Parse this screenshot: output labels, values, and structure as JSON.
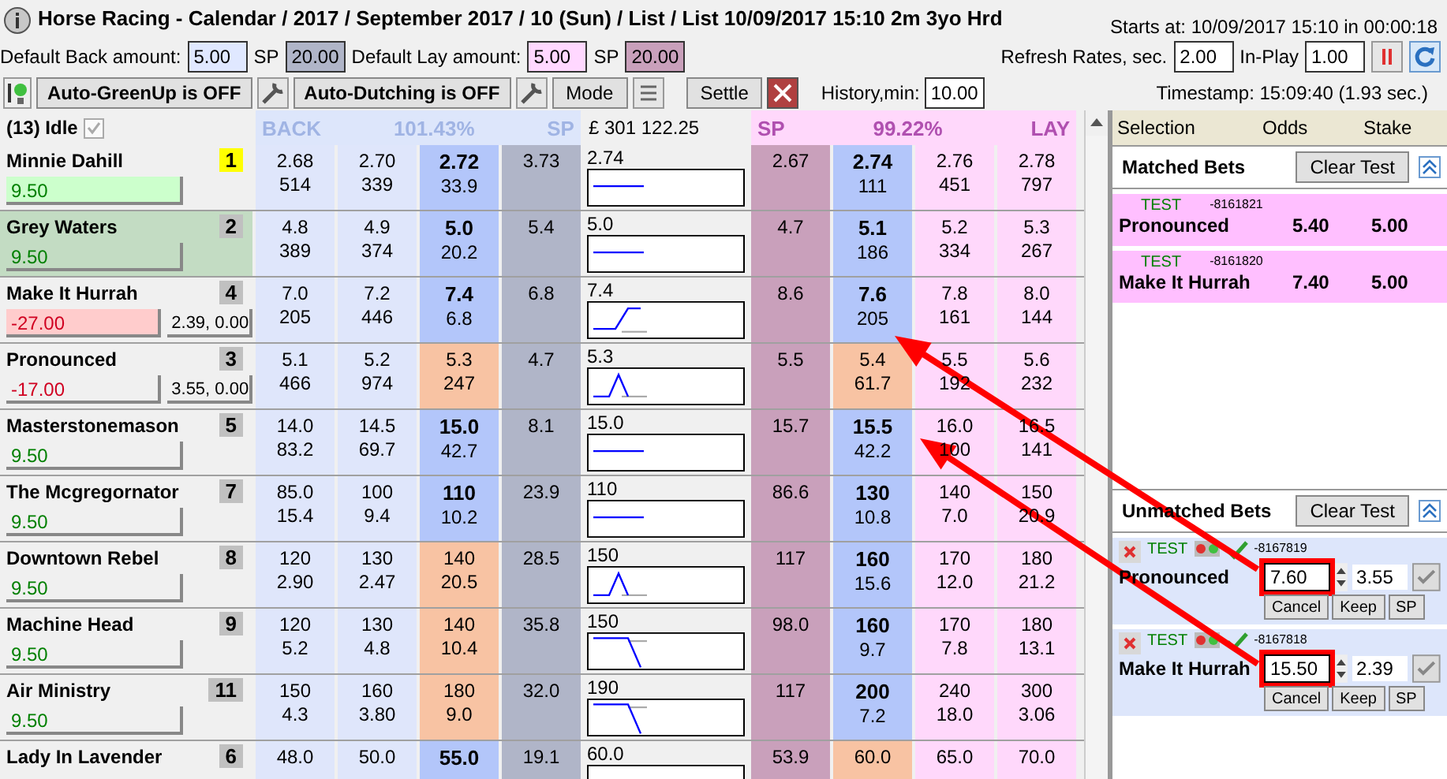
{
  "window": {
    "title": "Horse Racing - Calendar / 2017 / September 2017 / 10 (Sun) / List / List 10/09/2017 15:10 2m 3yo Hrd",
    "starts_at": "Starts at: 10/09/2017 15:10 in 00:00:18"
  },
  "amounts": {
    "back_label": "Default Back amount:",
    "back_value": "5.00",
    "back_sp_label": "SP",
    "back_sp_value": "20.00",
    "lay_label": "Default Lay amount:",
    "lay_value": "5.00",
    "lay_sp_label": "SP",
    "lay_sp_value": "20.00",
    "refresh_label": "Refresh Rates, sec.",
    "refresh_value": "2.00",
    "inplay_label": "In-Play",
    "inplay_value": "1.00"
  },
  "toolbar": {
    "greenup": "Auto-GreenUp is OFF",
    "dutching": "Auto-Dutching is OFF",
    "mode": "Mode",
    "settle": "Settle",
    "history_label": "History,min:",
    "history_value": "10.00",
    "timestamp": "Timestamp: 15:09:40 (1.93 sec.)"
  },
  "market": {
    "status": "(13) Idle",
    "status_checked": true,
    "back_label": "BACK",
    "back_percent": "101.43%",
    "back_sp": "SP",
    "matched": "£ 301 122.25",
    "lay_sp": "SP",
    "lay_percent": "99.22%",
    "lay_label": "LAY"
  },
  "runners": [
    {
      "name": "Minnie Dahill",
      "number": "1",
      "color": "#ffff00",
      "selected": false,
      "pl": {
        "value": "9.50",
        "kind": "profit",
        "highlighted": true
      },
      "back": [
        {
          "odds": "2.68",
          "amount": "514",
          "kind": "back"
        },
        {
          "odds": "2.70",
          "amount": "339",
          "kind": "back"
        },
        {
          "odds": "2.72",
          "amount": "33.9",
          "kind": "best"
        }
      ],
      "sp_back": "3.73",
      "chart_price": "2.74",
      "sparkline": {
        "kind": "flat"
      },
      "sp_lay": "2.67",
      "lay": [
        {
          "odds": "2.74",
          "amount": "111",
          "kind": "best"
        },
        {
          "odds": "2.76",
          "amount": "451",
          "kind": "lay"
        },
        {
          "odds": "2.78",
          "amount": "797",
          "kind": "lay"
        }
      ]
    },
    {
      "name": "Grey Waters",
      "number": "2",
      "color": "#c0c0c0",
      "selected": true,
      "pl": {
        "value": "9.50",
        "kind": "profit",
        "highlighted": false
      },
      "back": [
        {
          "odds": "4.8",
          "amount": "389",
          "kind": "back"
        },
        {
          "odds": "4.9",
          "amount": "374",
          "kind": "back"
        },
        {
          "odds": "5.0",
          "amount": "20.2",
          "kind": "best"
        }
      ],
      "sp_back": "5.4",
      "chart_price": "5.0",
      "sparkline": {
        "kind": "flat"
      },
      "sp_lay": "4.7",
      "lay": [
        {
          "odds": "5.1",
          "amount": "186",
          "kind": "best"
        },
        {
          "odds": "5.2",
          "amount": "334",
          "kind": "lay"
        },
        {
          "odds": "5.3",
          "amount": "267",
          "kind": "lay"
        }
      ]
    },
    {
      "name": "Make It Hurrah",
      "number": "4",
      "color": "#c0c0c0",
      "selected": false,
      "pl": {
        "value": "-27.00",
        "kind": "loss",
        "highlighted": true
      },
      "hedge": "2.39, 0.00",
      "back": [
        {
          "odds": "7.0",
          "amount": "205",
          "kind": "back"
        },
        {
          "odds": "7.2",
          "amount": "446",
          "kind": "back"
        },
        {
          "odds": "7.4",
          "amount": "6.8",
          "kind": "best"
        }
      ],
      "sp_back": "6.8",
      "chart_price": "7.4",
      "sparkline": {
        "kind": "rise"
      },
      "sp_lay": "8.6",
      "lay": [
        {
          "odds": "7.6",
          "amount": "205",
          "kind": "best"
        },
        {
          "odds": "7.8",
          "amount": "161",
          "kind": "lay"
        },
        {
          "odds": "8.0",
          "amount": "144",
          "kind": "lay"
        }
      ]
    },
    {
      "name": "Pronounced",
      "number": "3",
      "color": "#c0c0c0",
      "selected": false,
      "pl": {
        "value": "-17.00",
        "kind": "loss",
        "highlighted": false
      },
      "hedge": "3.55, 0.00",
      "back": [
        {
          "odds": "5.1",
          "amount": "466",
          "kind": "back"
        },
        {
          "odds": "5.2",
          "amount": "974",
          "kind": "back"
        },
        {
          "odds": "5.3",
          "amount": "247",
          "kind": "traded"
        }
      ],
      "sp_back": "4.7",
      "chart_price": "5.3",
      "sparkline": {
        "kind": "spike"
      },
      "sp_lay": "5.5",
      "lay": [
        {
          "odds": "5.4",
          "amount": "61.7",
          "kind": "traded"
        },
        {
          "odds": "5.5",
          "amount": "192",
          "kind": "lay"
        },
        {
          "odds": "5.6",
          "amount": "232",
          "kind": "lay"
        }
      ]
    },
    {
      "name": "Masterstonemason",
      "number": "5",
      "color": "#c0c0c0",
      "selected": false,
      "pl": {
        "value": "9.50",
        "kind": "profit",
        "highlighted": false
      },
      "back": [
        {
          "odds": "14.0",
          "amount": "83.2",
          "kind": "back"
        },
        {
          "odds": "14.5",
          "amount": "69.7",
          "kind": "back"
        },
        {
          "odds": "15.0",
          "amount": "42.7",
          "kind": "best"
        }
      ],
      "sp_back": "8.1",
      "chart_price": "15.0",
      "sparkline": {
        "kind": "flat"
      },
      "sp_lay": "15.7",
      "lay": [
        {
          "odds": "15.5",
          "amount": "42.2",
          "kind": "best"
        },
        {
          "odds": "16.0",
          "amount": "100",
          "kind": "lay"
        },
        {
          "odds": "16.5",
          "amount": "141",
          "kind": "lay"
        }
      ]
    },
    {
      "name": "The Mcgregornator",
      "number": "7",
      "color": "#c0c0c0",
      "selected": false,
      "pl": {
        "value": "9.50",
        "kind": "profit",
        "highlighted": false
      },
      "back": [
        {
          "odds": "85.0",
          "amount": "15.4",
          "kind": "back"
        },
        {
          "odds": "100",
          "amount": "9.4",
          "kind": "back"
        },
        {
          "odds": "110",
          "amount": "10.2",
          "kind": "best"
        }
      ],
      "sp_back": "23.9",
      "chart_price": "110",
      "sparkline": {
        "kind": "flat"
      },
      "sp_lay": "86.6",
      "lay": [
        {
          "odds": "130",
          "amount": "10.8",
          "kind": "best"
        },
        {
          "odds": "140",
          "amount": "7.0",
          "kind": "lay"
        },
        {
          "odds": "150",
          "amount": "20.9",
          "kind": "lay"
        }
      ]
    },
    {
      "name": "Downtown Rebel",
      "number": "8",
      "color": "#c0c0c0",
      "selected": false,
      "pl": {
        "value": "9.50",
        "kind": "profit",
        "highlighted": false
      },
      "back": [
        {
          "odds": "120",
          "amount": "2.90",
          "kind": "back"
        },
        {
          "odds": "130",
          "amount": "2.47",
          "kind": "back"
        },
        {
          "odds": "140",
          "amount": "20.5",
          "kind": "traded"
        }
      ],
      "sp_back": "28.5",
      "chart_price": "150",
      "sparkline": {
        "kind": "spike"
      },
      "sp_lay": "117",
      "lay": [
        {
          "odds": "160",
          "amount": "15.6",
          "kind": "best"
        },
        {
          "odds": "170",
          "amount": "12.0",
          "kind": "lay"
        },
        {
          "odds": "180",
          "amount": "21.2",
          "kind": "lay"
        }
      ]
    },
    {
      "name": "Machine Head",
      "number": "9",
      "color": "#c0c0c0",
      "selected": false,
      "pl": {
        "value": "9.50",
        "kind": "profit",
        "highlighted": false
      },
      "back": [
        {
          "odds": "120",
          "amount": "5.2",
          "kind": "back"
        },
        {
          "odds": "130",
          "amount": "4.8",
          "kind": "back"
        },
        {
          "odds": "140",
          "amount": "10.4",
          "kind": "traded"
        }
      ],
      "sp_back": "35.8",
      "chart_price": "150",
      "sparkline": {
        "kind": "drop"
      },
      "sp_lay": "98.0",
      "lay": [
        {
          "odds": "160",
          "amount": "9.7",
          "kind": "best"
        },
        {
          "odds": "170",
          "amount": "7.8",
          "kind": "lay"
        },
        {
          "odds": "180",
          "amount": "13.1",
          "kind": "lay"
        }
      ]
    },
    {
      "name": "Air Ministry",
      "number": "11",
      "color": "#c0c0c0",
      "selected": false,
      "pl": {
        "value": "9.50",
        "kind": "profit",
        "highlighted": false
      },
      "back": [
        {
          "odds": "150",
          "amount": "4.3",
          "kind": "back"
        },
        {
          "odds": "160",
          "amount": "3.80",
          "kind": "back"
        },
        {
          "odds": "180",
          "amount": "9.0",
          "kind": "traded"
        }
      ],
      "sp_back": "32.0",
      "chart_price": "190",
      "sparkline": {
        "kind": "drop"
      },
      "sp_lay": "117",
      "lay": [
        {
          "odds": "200",
          "amount": "7.2",
          "kind": "best"
        },
        {
          "odds": "240",
          "amount": "18.0",
          "kind": "lay"
        },
        {
          "odds": "300",
          "amount": "3.06",
          "kind": "lay"
        }
      ]
    },
    {
      "name": "Lady In Lavender",
      "number": "6",
      "color": "#c0c0c0",
      "selected": false,
      "back": [
        {
          "odds": "48.0",
          "kind": "back"
        },
        {
          "odds": "50.0",
          "kind": "back"
        },
        {
          "odds": "55.0",
          "kind": "best"
        }
      ],
      "sp_back": "19.1",
      "chart_price": "60.0",
      "sp_lay": "53.9",
      "lay": [
        {
          "odds": "60.0",
          "kind": "traded"
        },
        {
          "odds": "65.0",
          "kind": "lay"
        },
        {
          "odds": "70.0",
          "kind": "lay"
        }
      ]
    }
  ],
  "bets_panel": {
    "columns": [
      "Selection",
      "Odds",
      "Stake"
    ],
    "matched_title": "Matched Bets",
    "matched_clear_label": "Clear Test",
    "matched": [
      {
        "tag": "TEST",
        "ref": "-8161821",
        "selection": "Pronounced",
        "odds": "5.40",
        "stake": "5.00"
      },
      {
        "tag": "TEST",
        "ref": "-8161820",
        "selection": "Make It Hurrah",
        "odds": "7.40",
        "stake": "5.00"
      }
    ],
    "unmatched_title": "Unmatched Bets",
    "unmatched_clear_label": "Clear Test",
    "unmatched": [
      {
        "tag": "TEST",
        "ref": "-8167819",
        "selection": "Pronounced",
        "odds": "7.60",
        "stake": "3.55",
        "flagged": true,
        "actions": [
          "Cancel",
          "Keep",
          "SP"
        ]
      },
      {
        "tag": "TEST",
        "ref": "-8167818",
        "selection": "Make It Hurrah",
        "odds": "15.50",
        "stake": "2.39",
        "flagged": true,
        "actions": [
          "Cancel",
          "Keep",
          "SP"
        ]
      }
    ]
  }
}
